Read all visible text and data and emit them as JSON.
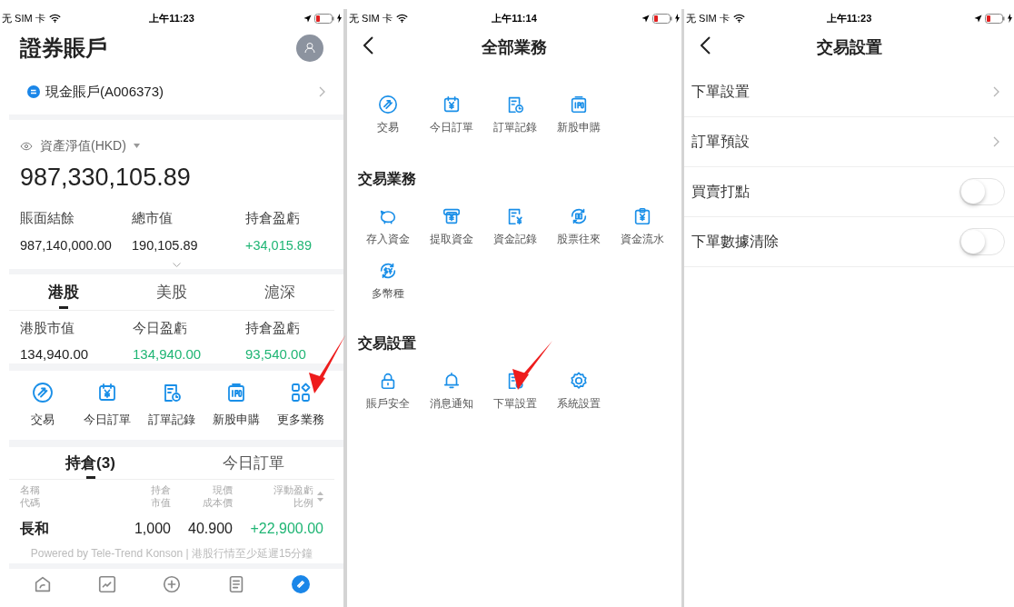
{
  "account_screen": {
    "status_bar": {
      "carrier": "无 SIM 卡",
      "time": "上午11:23"
    },
    "title": "證券賬戶",
    "account": "現金賬戶(A006373)",
    "asset_label": "資產淨值(HKD)",
    "asset_value": "987,330,105.89",
    "summary": [
      {
        "label": "賬面結餘",
        "value": "987,140,000.00",
        "color": "#222222"
      },
      {
        "label": "總市值",
        "value": "190,105.89",
        "color": "#222222"
      },
      {
        "label": "持倉盈虧",
        "value": "+34,015.89",
        "color": "#1fb574"
      }
    ],
    "market_tabs": [
      {
        "label": "港股",
        "selected": true
      },
      {
        "label": "美股",
        "selected": false
      },
      {
        "label": "滬深",
        "selected": false
      }
    ],
    "market_summary": [
      {
        "label": "港股市值",
        "value": "134,940.00",
        "color": "#222222"
      },
      {
        "label": "今日盈虧",
        "value": "134,940.00",
        "color": "#1fb574"
      },
      {
        "label": "持倉盈虧",
        "value": "93,540.00",
        "color": "#1fb574"
      }
    ],
    "shortcuts": [
      {
        "kind": "swap",
        "label": "交易"
      },
      {
        "kind": "calendar",
        "label": "今日訂單"
      },
      {
        "kind": "doc-clock",
        "label": "訂單記錄"
      },
      {
        "kind": "ipo",
        "label": "新股申購"
      },
      {
        "kind": "grid",
        "label": "更多業務"
      }
    ],
    "holding_tabs": [
      {
        "label": "持倉(3)",
        "selected": true
      },
      {
        "label": "今日訂單",
        "selected": false
      }
    ],
    "columns": [
      {
        "line1": "名稱",
        "line2": "代碼"
      },
      {
        "line1": "持倉",
        "line2": "市值"
      },
      {
        "line1": "現價",
        "line2": "成本價"
      },
      {
        "line1": "浮動盈虧",
        "line2": "比例"
      }
    ],
    "rows": [
      {
        "name": "長和",
        "qty": "1,000",
        "price": "40.900",
        "pnl": "+22,900.00",
        "color": "#1fb574"
      }
    ],
    "footer": "Powered by Tele-Trend Konson | 港股行情至少延遲15分鐘",
    "bottom_nav": [
      {
        "kind": "home",
        "selected": false
      },
      {
        "kind": "chart",
        "selected": false
      },
      {
        "kind": "plus",
        "selected": false
      },
      {
        "kind": "doc",
        "selected": false
      },
      {
        "kind": "trade",
        "selected": true
      }
    ]
  },
  "all_business_screen": {
    "status_bar": {
      "carrier": "无 SIM 卡",
      "time": "上午11:14"
    },
    "title": "全部業務",
    "sections": [
      {
        "items": [
          {
            "kind": "swap",
            "label": "交易"
          },
          {
            "kind": "calendar",
            "label": "今日訂單"
          },
          {
            "kind": "doc-clock",
            "label": "訂單記錄"
          },
          {
            "kind": "ipo",
            "label": "新股申購"
          }
        ]
      },
      {
        "title": "交易業務",
        "items": [
          {
            "kind": "piggy",
            "label": "存入資金"
          },
          {
            "kind": "withdraw",
            "label": "提取資金"
          },
          {
            "kind": "doc-yen",
            "label": "資金記錄"
          },
          {
            "kind": "candle",
            "label": "股票往來"
          },
          {
            "kind": "clipboard",
            "label": "資金流水"
          },
          {
            "kind": "currency",
            "label": "多幣種"
          }
        ]
      },
      {
        "title": "交易設置",
        "items": [
          {
            "kind": "lock",
            "label": "賬戶安全"
          },
          {
            "kind": "bell",
            "label": "消息通知"
          },
          {
            "kind": "doc-gear",
            "label": "下單設置"
          },
          {
            "kind": "gear",
            "label": "系統設置"
          }
        ]
      }
    ]
  },
  "trade_settings_screen": {
    "status_bar": {
      "carrier": "无 SIM 卡",
      "time": "上午11:23"
    },
    "title": "交易設置",
    "rows": [
      {
        "kind": "link",
        "label": "下單設置"
      },
      {
        "kind": "link",
        "label": "訂單預設"
      },
      {
        "kind": "toggle",
        "label": "買賣打點",
        "on": false
      },
      {
        "kind": "toggle",
        "label": "下單數據清除",
        "on": false
      }
    ]
  }
}
